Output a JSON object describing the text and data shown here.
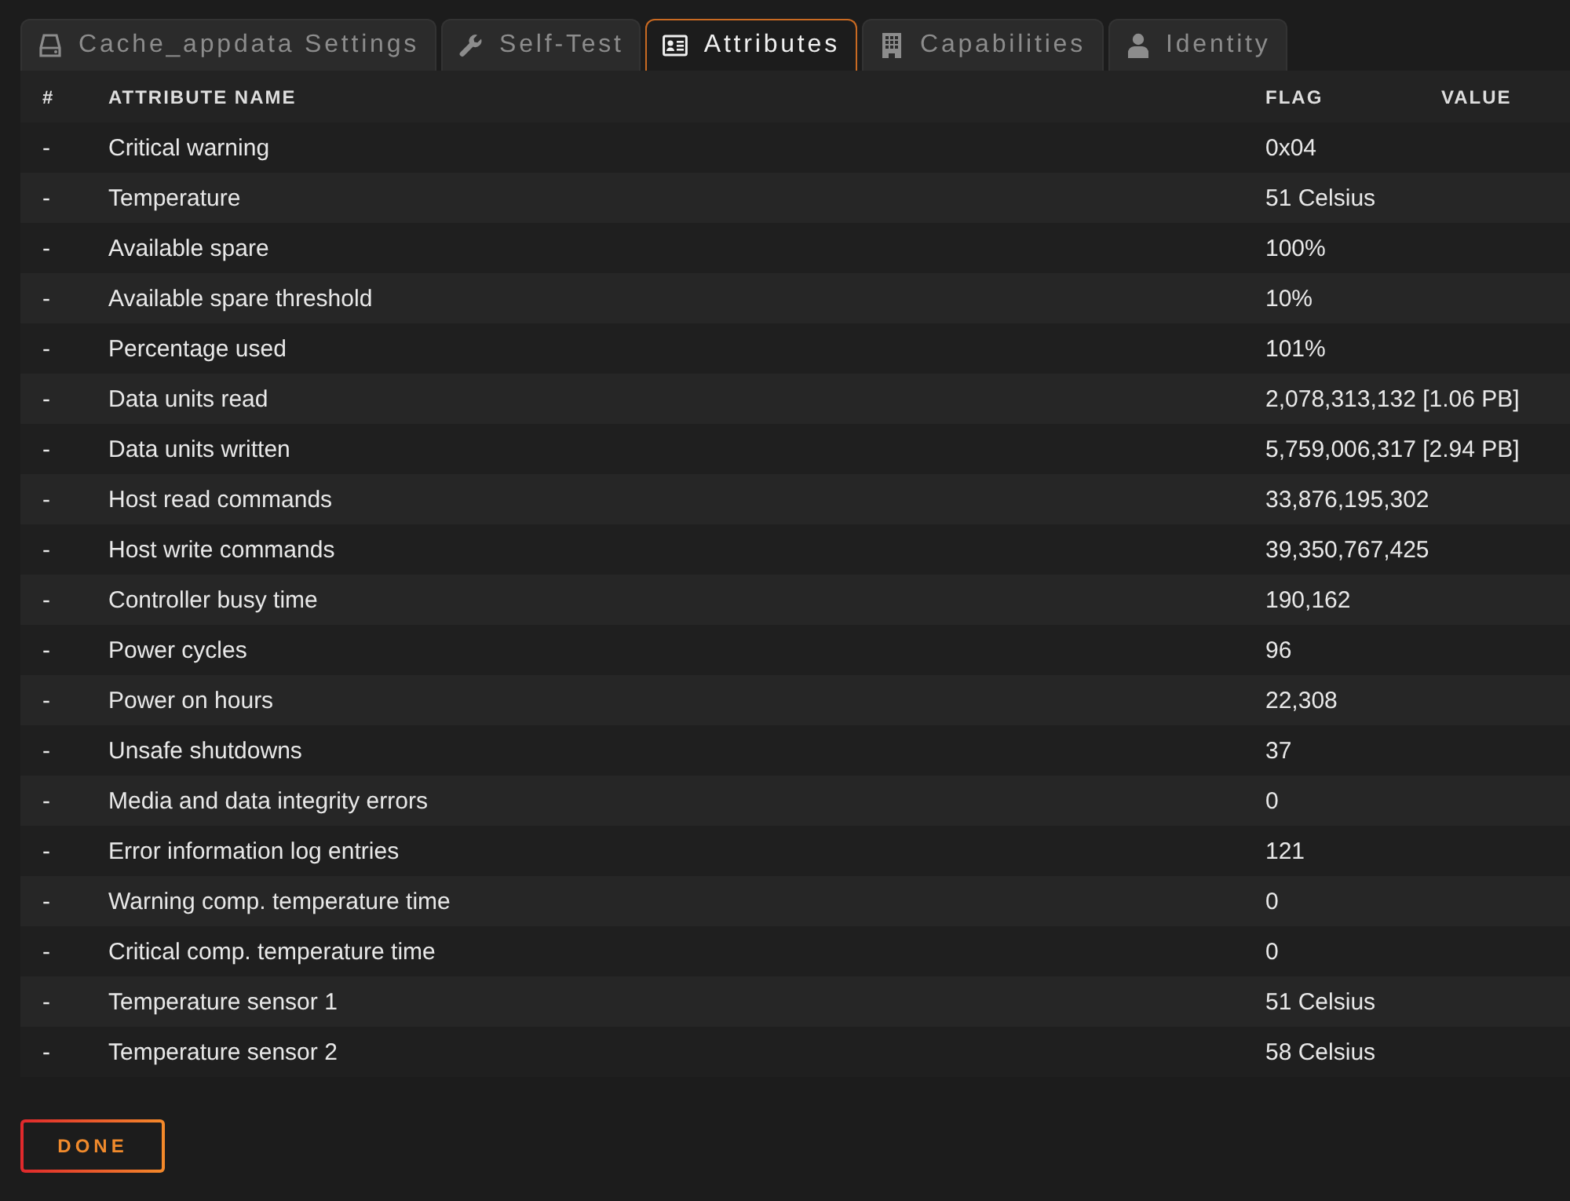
{
  "tabs": [
    {
      "label": "Cache_appdata Settings",
      "selected": false
    },
    {
      "label": "Self-Test",
      "selected": false
    },
    {
      "label": "Attributes",
      "selected": true
    },
    {
      "label": "Capabilities",
      "selected": false
    },
    {
      "label": "Identity",
      "selected": false
    }
  ],
  "table": {
    "columns": [
      "#",
      "ATTRIBUTE NAME",
      "FLAG",
      "VALUE"
    ],
    "rows": [
      {
        "cells": [
          "-",
          "Critical warning",
          "0x04"
        ]
      },
      {
        "cells": [
          "-",
          "Temperature",
          "51 Celsius"
        ]
      },
      {
        "cells": [
          "-",
          "Available spare",
          "100%"
        ]
      },
      {
        "cells": [
          "-",
          "Available spare threshold",
          "10%"
        ]
      },
      {
        "cells": [
          "-",
          "Percentage used",
          "101%"
        ]
      },
      {
        "cells": [
          "-",
          "Data units read",
          "2,078,313,132 [1.06 PB]"
        ]
      },
      {
        "cells": [
          "-",
          "Data units written",
          "5,759,006,317 [2.94 PB]"
        ]
      },
      {
        "cells": [
          "-",
          "Host read commands",
          "33,876,195,302"
        ]
      },
      {
        "cells": [
          "-",
          "Host write commands",
          "39,350,767,425"
        ]
      },
      {
        "cells": [
          "-",
          "Controller busy time",
          "190,162"
        ]
      },
      {
        "cells": [
          "-",
          "Power cycles",
          "96"
        ]
      },
      {
        "cells": [
          "-",
          "Power on hours",
          "22,308"
        ]
      },
      {
        "cells": [
          "-",
          "Unsafe shutdowns",
          "37"
        ]
      },
      {
        "cells": [
          "-",
          "Media and data integrity errors",
          "0"
        ]
      },
      {
        "cells": [
          "-",
          "Error information log entries",
          "121"
        ]
      },
      {
        "cells": [
          "-",
          "Warning comp. temperature time",
          "0"
        ]
      },
      {
        "cells": [
          "-",
          "Critical comp. temperature time",
          "0"
        ]
      },
      {
        "cells": [
          "-",
          "Temperature sensor 1",
          "51 Celsius"
        ]
      },
      {
        "cells": [
          "-",
          "Temperature sensor 2",
          "58 Celsius"
        ]
      }
    ]
  },
  "buttons": [
    "DONE"
  ]
}
